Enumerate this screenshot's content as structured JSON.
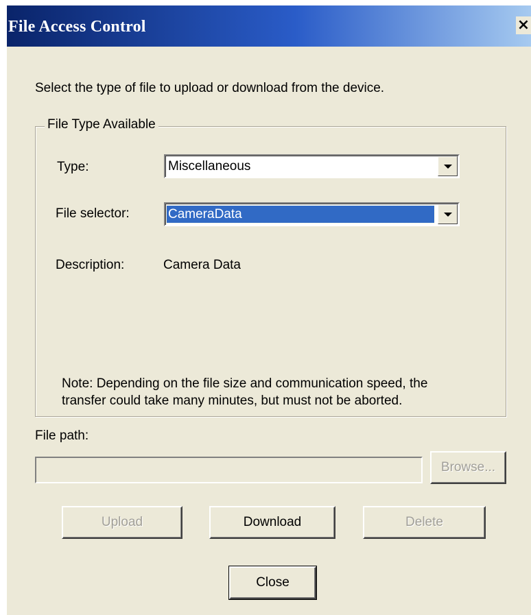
{
  "window": {
    "title": "File Access Control",
    "close_glyph": "×"
  },
  "instruction": "Select the type of file to upload or download from the device.",
  "group": {
    "legend": "File Type Available",
    "type_label": "Type:",
    "type_value": "Miscellaneous",
    "file_selector_label": "File selector:",
    "file_selector_value": "CameraData",
    "description_label": "Description:",
    "description_value": "Camera Data",
    "note_line1": "Note: Depending on the file size and communication speed, the",
    "note_line2": "transfer could take many minutes, but must not be aborted."
  },
  "file_path": {
    "label": "File path:",
    "value": "",
    "browse_label": "Browse..."
  },
  "buttons": {
    "upload": "Upload",
    "download": "Download",
    "delete": "Delete",
    "close": "Close"
  },
  "icons": {
    "dropdown": "chevron-down-icon",
    "close": "close-icon"
  }
}
